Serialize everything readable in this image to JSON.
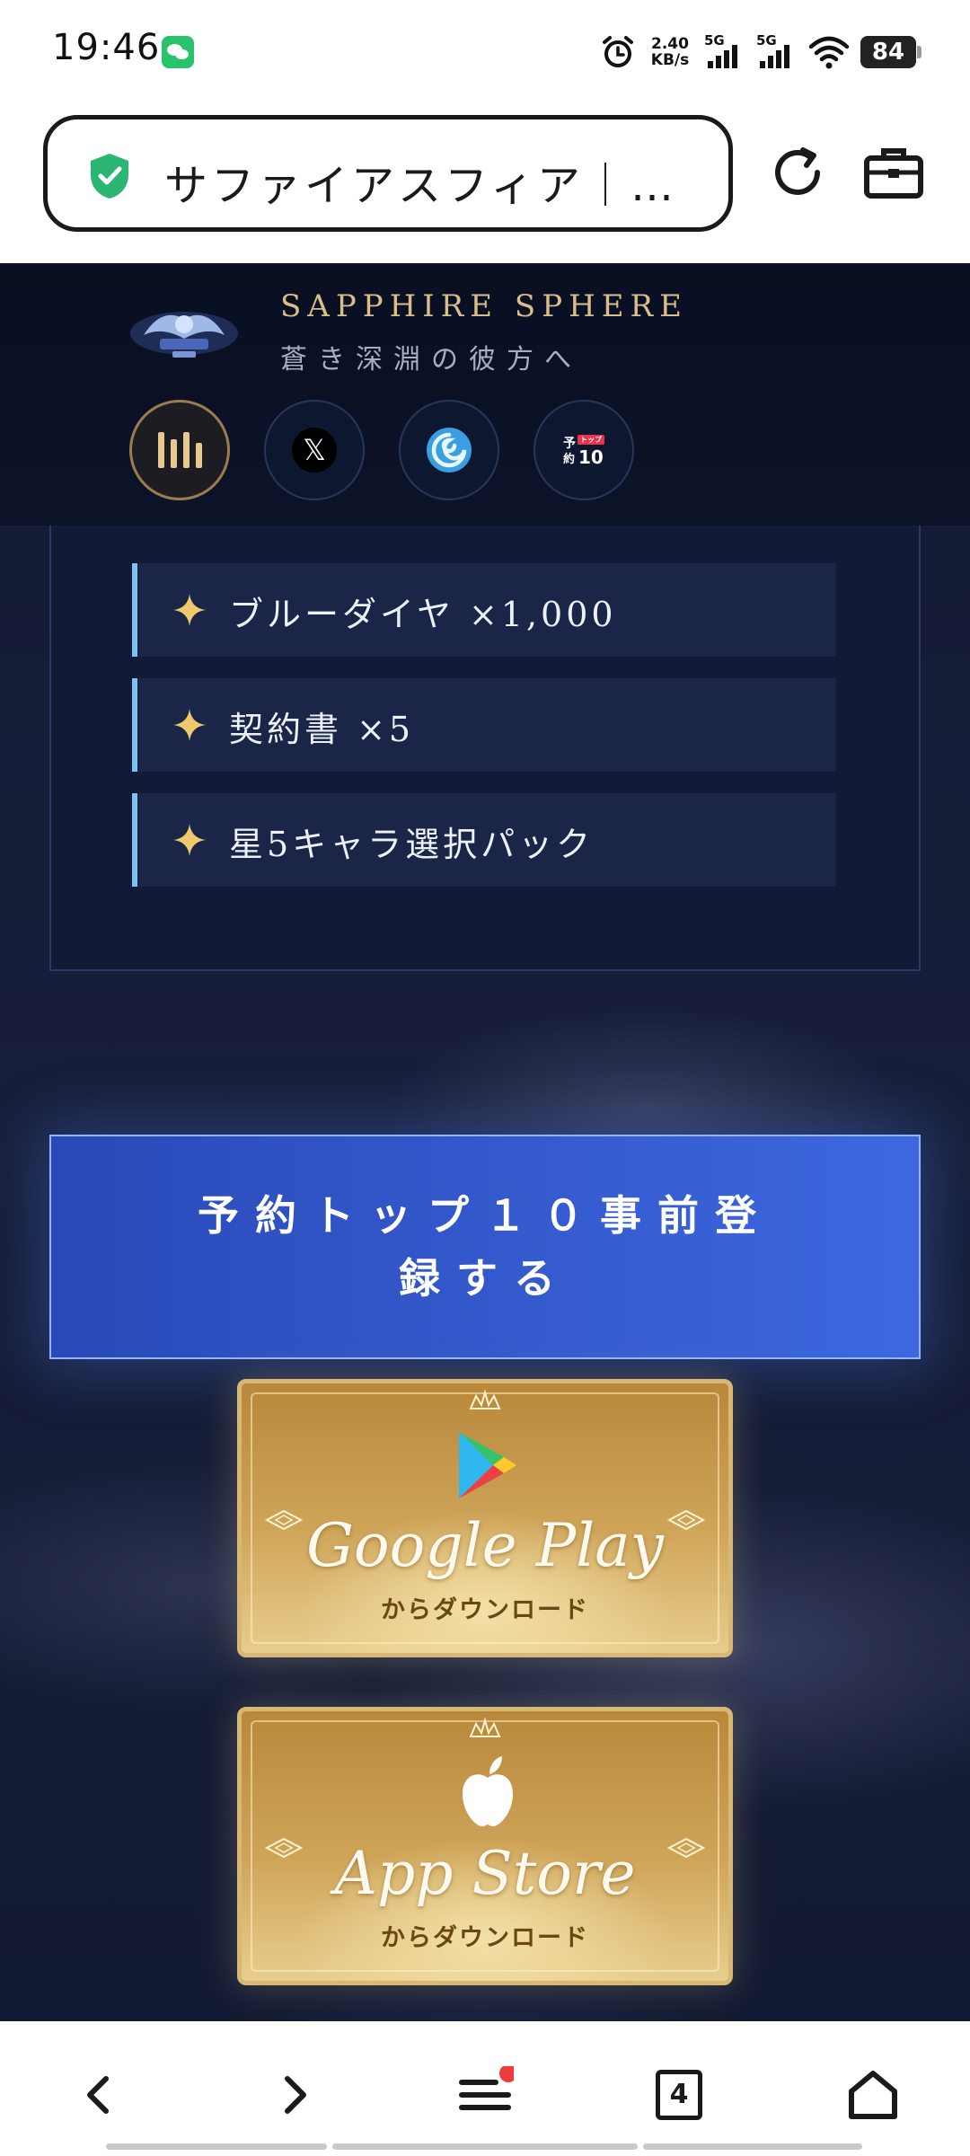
{
  "status_bar": {
    "time": "19:46",
    "net_speed_value": "2.40",
    "net_speed_unit": "KB/s",
    "sim1_label": "5G",
    "sim2_label": "5G",
    "battery": "84",
    "icons": [
      "wechat-icon",
      "alarm-icon",
      "signal-icon",
      "wifi-icon",
      "battery-icon"
    ]
  },
  "browser": {
    "url_title": "サファイアスフィア｜…",
    "icons": [
      "shield-icon",
      "reload-icon",
      "briefcase-icon"
    ]
  },
  "site_header": {
    "title": "SAPPHIRE SPHERE",
    "tagline": "蒼き深淵の彼方へ",
    "nav": [
      {
        "name": "menu",
        "icon": "bars-icon",
        "active": true
      },
      {
        "name": "x",
        "icon": "x-icon",
        "glyph": "𝕏"
      },
      {
        "name": "swirl",
        "icon": "swirl-icon"
      },
      {
        "name": "rank",
        "icon": "rank-badge-icon",
        "text_top": "予",
        "text_bottom": "約",
        "badge": "トップ",
        "number": "10"
      }
    ]
  },
  "rewards": [
    {
      "label": "ブルーダイヤ ×1,000"
    },
    {
      "label": "契約書 ×5"
    },
    {
      "label": "星5キャラ選択パック"
    }
  ],
  "cta": {
    "label": "予約トップ１０事前登録する"
  },
  "stores": [
    {
      "name": "Google Play",
      "sub": "からダウンロード",
      "icon": "google-play-icon"
    },
    {
      "name": "App Store",
      "sub": "からダウンロード",
      "icon": "apple-icon"
    }
  ],
  "bottom_bar": {
    "tab_count": "4",
    "menu_has_notification": true,
    "icons": [
      "back-icon",
      "forward-icon",
      "menu-icon",
      "tabs-icon",
      "home-icon"
    ]
  },
  "colors": {
    "accent_gold": "#d9bf87",
    "cta_blue": "#3d68e0",
    "reward_border": "#7ec3f0",
    "notification_red": "#ee3b3b"
  }
}
